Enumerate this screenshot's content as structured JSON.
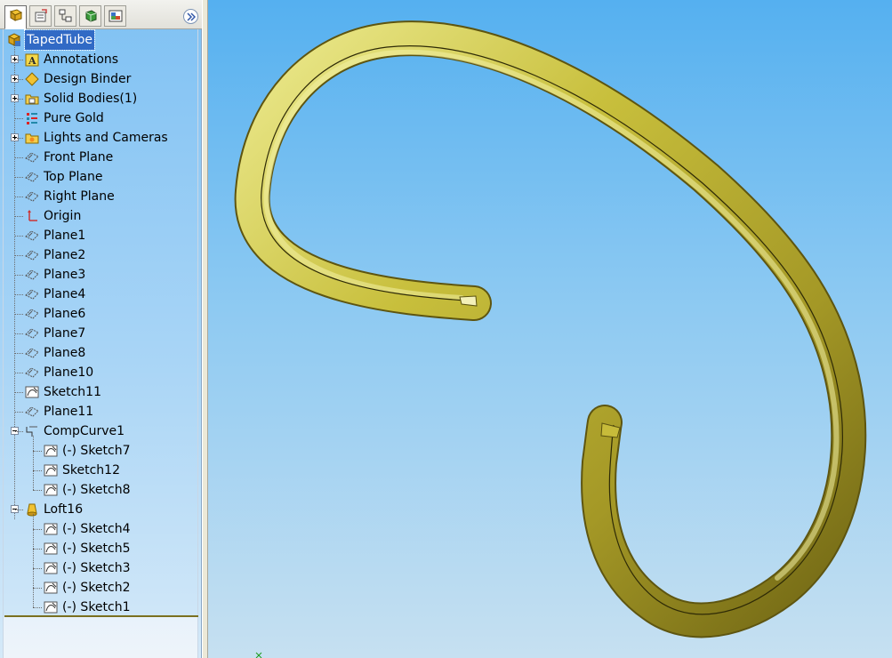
{
  "toolbar": {
    "tabs": [
      {
        "name": "FeatureManager design tree",
        "icon": "feature-tree-icon",
        "active": true
      },
      {
        "name": "PropertyManager",
        "icon": "property-manager-icon",
        "active": false
      },
      {
        "name": "ConfigurationManager",
        "icon": "configuration-manager-icon",
        "active": false
      },
      {
        "name": "DimXpertManager",
        "icon": "dimxpert-icon",
        "active": false
      },
      {
        "name": "DisplayManager",
        "icon": "display-manager-icon",
        "active": false
      }
    ],
    "expand_icon": "double-chevron-right-icon"
  },
  "tree": {
    "root": "TapedTube",
    "items": [
      {
        "label": "Annotations",
        "icon": "annotations-icon",
        "expander": "plus"
      },
      {
        "label": "Design Binder",
        "icon": "design-binder-icon",
        "expander": "plus"
      },
      {
        "label": "Solid Bodies(1)",
        "icon": "solid-bodies-folder-icon",
        "expander": "plus"
      },
      {
        "label": "Pure Gold",
        "icon": "material-icon",
        "expander": "none"
      },
      {
        "label": "Lights and Cameras",
        "icon": "lights-cameras-folder-icon",
        "expander": "plus"
      },
      {
        "label": "Front Plane",
        "icon": "plane-icon",
        "expander": "none"
      },
      {
        "label": "Top Plane",
        "icon": "plane-icon",
        "expander": "none"
      },
      {
        "label": "Right Plane",
        "icon": "plane-icon",
        "expander": "none"
      },
      {
        "label": "Origin",
        "icon": "origin-icon",
        "expander": "none"
      },
      {
        "label": "Plane1",
        "icon": "plane-icon",
        "expander": "none"
      },
      {
        "label": "Plane2",
        "icon": "plane-icon",
        "expander": "none"
      },
      {
        "label": "Plane3",
        "icon": "plane-icon",
        "expander": "none"
      },
      {
        "label": "Plane4",
        "icon": "plane-icon",
        "expander": "none"
      },
      {
        "label": "Plane6",
        "icon": "plane-icon",
        "expander": "none"
      },
      {
        "label": "Plane7",
        "icon": "plane-icon",
        "expander": "none"
      },
      {
        "label": "Plane8",
        "icon": "plane-icon",
        "expander": "none"
      },
      {
        "label": "Plane10",
        "icon": "plane-icon",
        "expander": "none"
      },
      {
        "label": "Sketch11",
        "icon": "sketch-icon",
        "expander": "none"
      },
      {
        "label": "Plane11",
        "icon": "plane-icon",
        "expander": "none"
      },
      {
        "label": "CompCurve1",
        "icon": "composite-curve-icon",
        "expander": "minus",
        "children": [
          {
            "label": "(-) Sketch7",
            "icon": "sketch-icon"
          },
          {
            "label": "Sketch12",
            "icon": "sketch-icon"
          },
          {
            "label": "(-) Sketch8",
            "icon": "sketch-icon"
          }
        ]
      },
      {
        "label": "Loft16",
        "icon": "loft-icon",
        "expander": "minus",
        "children": [
          {
            "label": "(-) Sketch4",
            "icon": "sketch-icon"
          },
          {
            "label": "(-) Sketch5",
            "icon": "sketch-icon"
          },
          {
            "label": "(-) Sketch3",
            "icon": "sketch-icon"
          },
          {
            "label": "(-) Sketch2",
            "icon": "sketch-icon"
          },
          {
            "label": "(-) Sketch1",
            "icon": "sketch-icon"
          }
        ]
      }
    ]
  },
  "viewport": {
    "model": "tapered tube loft",
    "material_color": "#b9ad3a",
    "background_top": "#55b0f0",
    "background_bottom": "#c6e0f1",
    "triad_icon": "coordinate-triad-icon"
  }
}
